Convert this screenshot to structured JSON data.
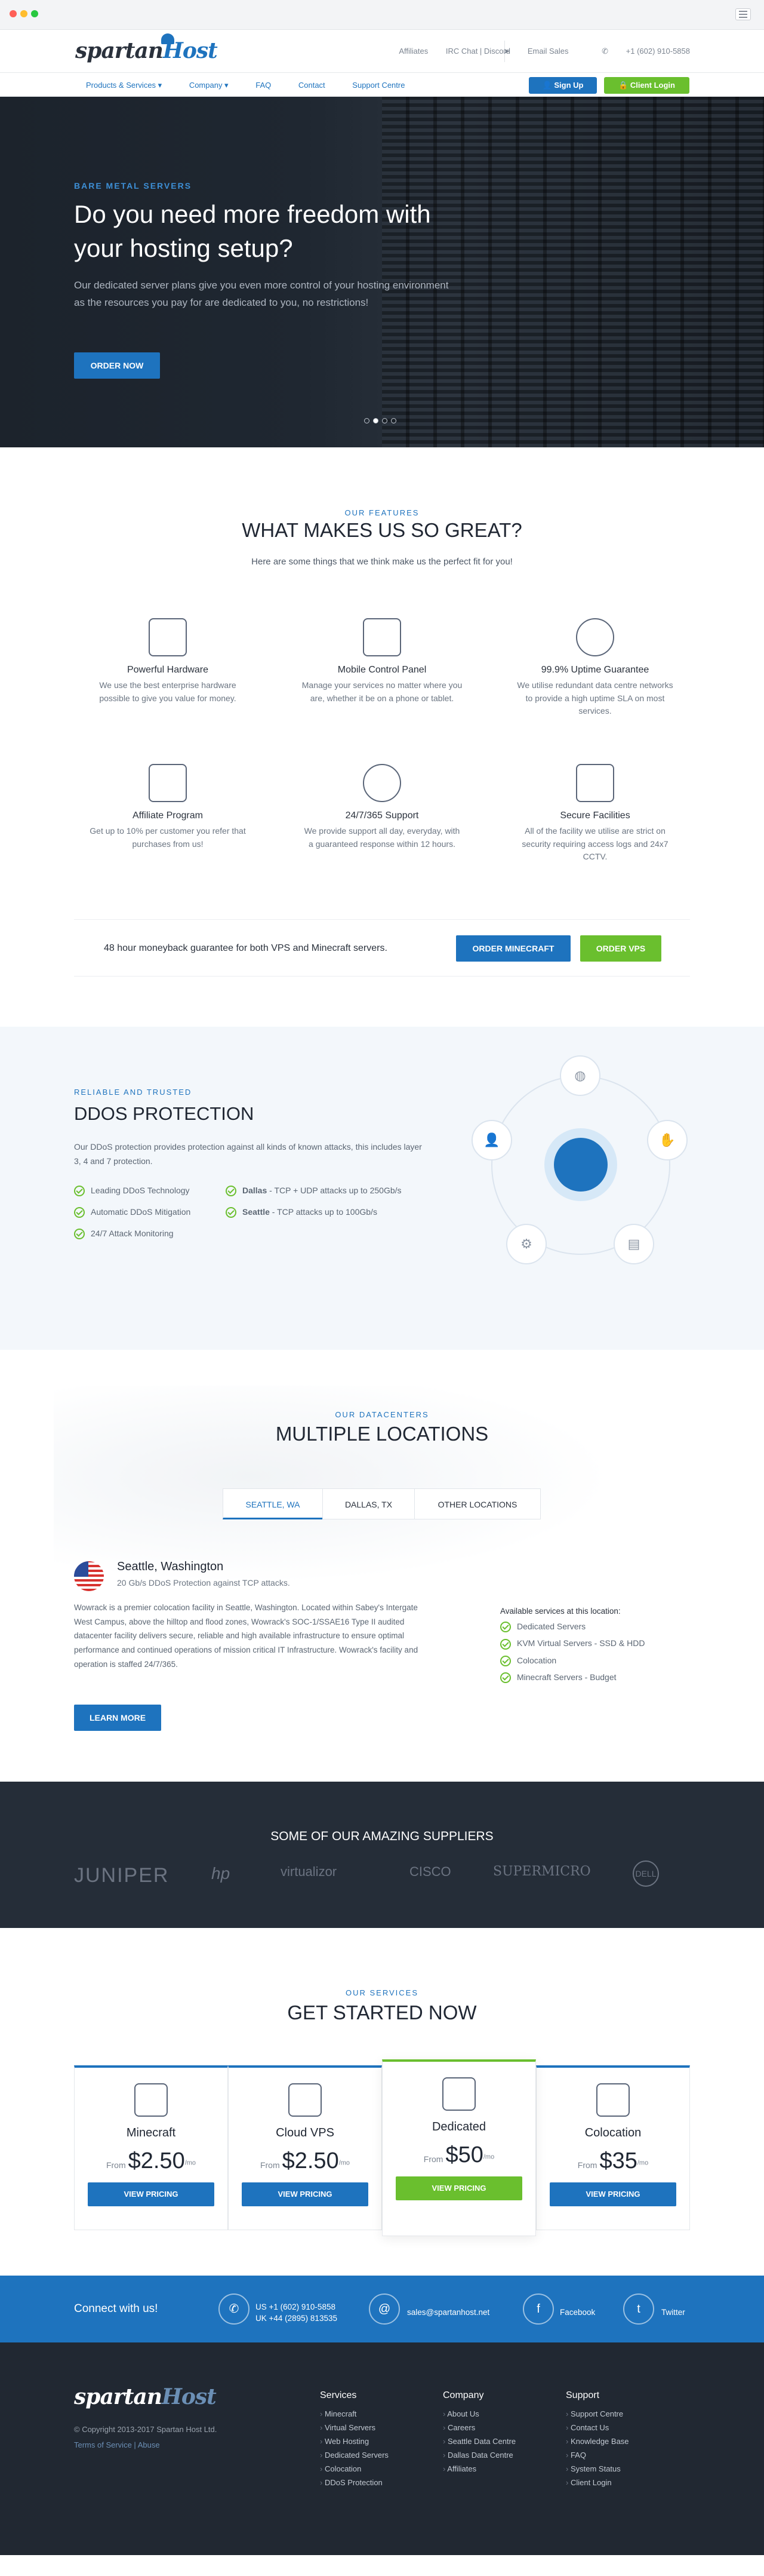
{
  "header": {
    "logo": "spartan",
    "logo_b": "Host",
    "top_links": [
      "Affiliates",
      "IRC Chat | Discord"
    ],
    "email": "Email Sales",
    "phone": "+1 (602) 910-5858",
    "nav": [
      "Products & Services ▾",
      "Company ▾",
      "FAQ",
      "Contact",
      "Support Centre"
    ],
    "signup": "Sign Up",
    "client_login": "Client Login"
  },
  "hero": {
    "eyebrow": "BARE METAL SERVERS",
    "title": "Do you need more freedom with your hosting setup?",
    "text": "Our dedicated server plans give you even more control of your hosting environment as the resources you pay for are dedicated to you, no restrictions!",
    "button": "ORDER NOW"
  },
  "features": {
    "eyebrow": "OUR FEATURES",
    "title": "WHAT MAKES US SO GREAT?",
    "subtitle": "Here are some things that we think make us the perfect fit for you!",
    "items": [
      {
        "title": "Powerful Hardware",
        "desc": "We use the best enterprise hardware possible to give you value for money.",
        "icon": "cpu-icon"
      },
      {
        "title": "Mobile Control Panel",
        "desc": "Manage your services no matter where you are, whether it be on a phone or tablet.",
        "icon": "monitor-icon"
      },
      {
        "title": "99.9% Uptime Guarantee",
        "desc": "We utilise redundant data centre networks to provide a high uptime SLA on most services.",
        "icon": "gauge-icon"
      },
      {
        "title": "Affiliate Program",
        "desc": "Get up to 10% per customer you refer that purchases from us!",
        "icon": "handshake-icon"
      },
      {
        "title": "24/7/365 Support",
        "desc": "We provide support all day, everyday, with a guaranteed response within 12 hours.",
        "icon": "lifebuoy-icon"
      },
      {
        "title": "Secure Facilities",
        "desc": "All of the facility we utilise are strict on security requiring access logs and 24x7 CCTV.",
        "icon": "lock-icon"
      }
    ],
    "cta_text": "48 hour moneyback guarantee for both VPS and Minecraft servers.",
    "cta_minecraft": "ORDER MINECRAFT",
    "cta_vps": "ORDER VPS"
  },
  "ddos": {
    "eyebrow": "RELIABLE AND TRUSTED",
    "title": "DDOS PROTECTION",
    "text": "Our DDoS protection provides protection against all kinds of known attacks, this includes layer 3, 4 and 7 protection.",
    "checks": [
      "Leading DDoS Technology",
      "Automatic DDoS Mitigation",
      "24/7 Attack Monitoring"
    ],
    "dallas_b": "Dallas",
    "dallas": " - TCP + UDP attacks up to 250Gb/s",
    "seattle_b": "Seattle",
    "seattle": " - TCP attacks up to 100Gb/s"
  },
  "locations": {
    "eyebrow": "OUR DATACENTERS",
    "title": "MULTIPLE LOCATIONS",
    "tabs": [
      "SEATTLE, WA",
      "DALLAS, TX",
      "OTHER LOCATIONS"
    ],
    "city": "Seattle, Washington",
    "city_sub": "20 Gb/s DDoS Protection against TCP attacks.",
    "desc": "Wowrack is a premier colocation facility in Seattle, Washington. Located within Sabey's Intergate West Campus, above the hilltop and flood zones, Wowrack's SOC-1/SSAE16 Type II audited datacenter facility delivers secure, reliable and high available infrastructure to ensure optimal performance and continued operations of mission critical IT Infrastructure. Wowrack's facility and operation is staffed 24/7/365.",
    "avail_title": "Available services at this location:",
    "avail": [
      "Dedicated Servers",
      "KVM Virtual Servers - SSD & HDD",
      "Colocation",
      "Minecraft Servers - Budget"
    ],
    "learn": "LEARN MORE"
  },
  "suppliers": {
    "title": "SOME OF OUR AMAZING SUPPLIERS",
    "logos": [
      "JUNIPER",
      "hp",
      "virtualizor",
      "CISCO",
      "SUPERMICRO",
      "DELL"
    ]
  },
  "services": {
    "eyebrow": "OUR SERVICES",
    "title": "GET STARTED NOW",
    "from": "From",
    "per": "/mo",
    "button": "VIEW PRICING",
    "plans": [
      {
        "name": "Minecraft",
        "price": "$2.50"
      },
      {
        "name": "Cloud VPS",
        "price": "$2.50"
      },
      {
        "name": "Dedicated",
        "price": "$50"
      },
      {
        "name": "Colocation",
        "price": "$35"
      }
    ]
  },
  "connect": {
    "title": "Connect with us!",
    "us": "US +1 (602) 910-5858",
    "uk": "UK +44 (2895) 813535",
    "email": "sales@spartanhost.net",
    "facebook": "Facebook",
    "twitter": "Twitter"
  },
  "footer": {
    "copyright": "© Copyright 2013-2017 Spartan Host Ltd.",
    "terms": "Terms of Service",
    "abuse": "Abuse",
    "services_title": "Services",
    "services": [
      "Minecraft",
      "Virtual Servers",
      "Web Hosting",
      "Dedicated Servers",
      "Colocation",
      "DDoS Protection"
    ],
    "company_title": "Company",
    "company": [
      "About Us",
      "Careers",
      "Seattle Data Centre",
      "Dallas Data Centre",
      "Affiliates"
    ],
    "support_title": "Support",
    "support": [
      "Support Centre",
      "Contact Us",
      "Knowledge Base",
      "FAQ",
      "System Status",
      "Client Login"
    ]
  }
}
